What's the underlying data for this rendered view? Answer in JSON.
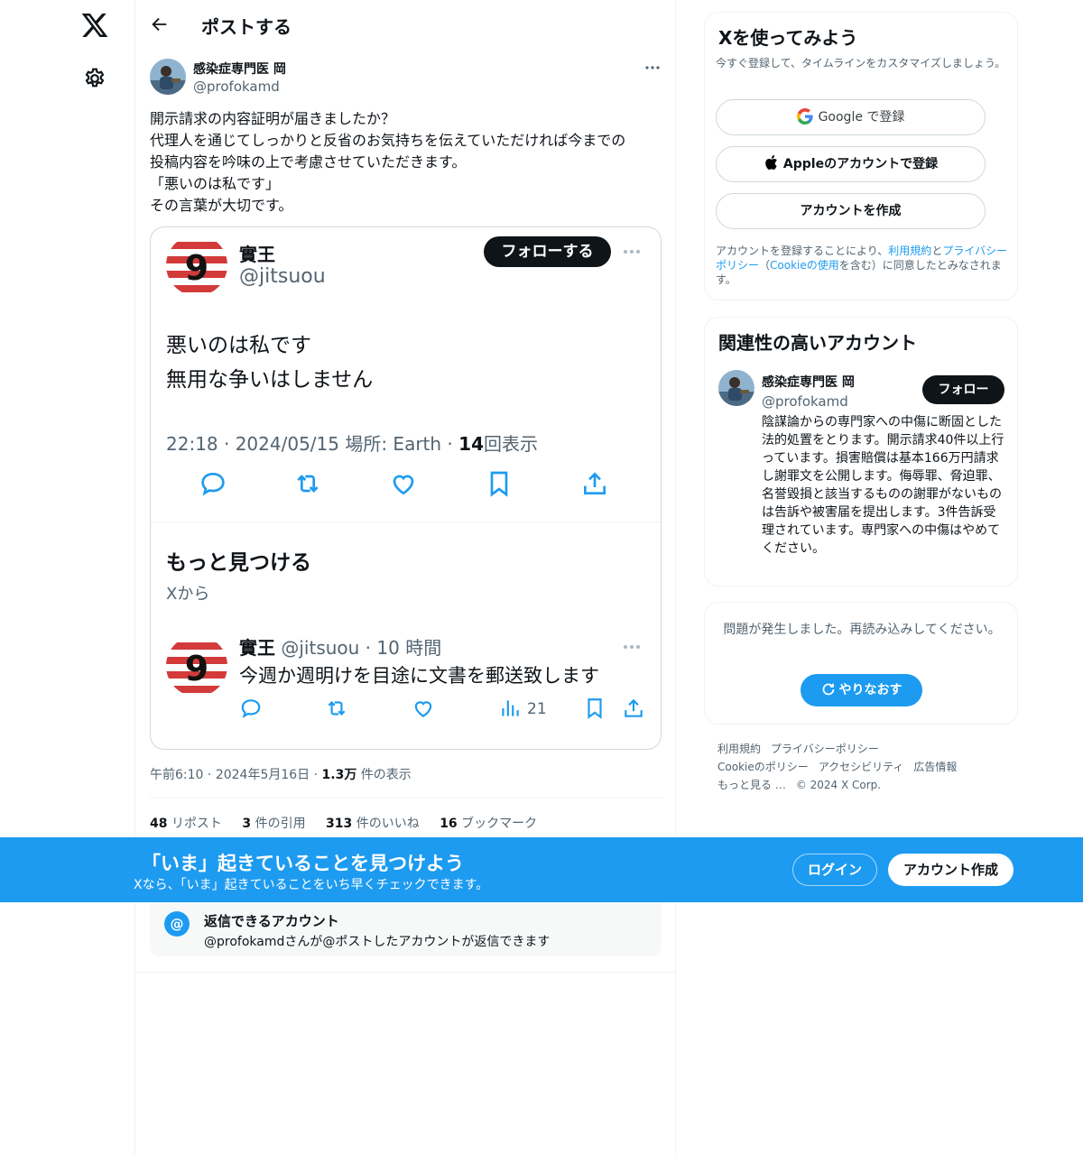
{
  "nav": {
    "logo": "x-logo",
    "settings_icon": "gear-icon"
  },
  "header": {
    "title": "ポストする"
  },
  "post": {
    "author_name": "感染症専門医 岡",
    "author_handle": "@profokamd",
    "text_lines": [
      "開示請求の内容証明が届きましたか？",
      "代理人を通じてしっかりと反省のお気持ちを伝えていただければ今までの",
      "投稿内容を吟味の上で考慮させていただきます。",
      "「悪いのは私です」",
      "その言葉が大切です。"
    ],
    "time": "午前6:10",
    "date": "2024年5月16日",
    "views_count": "1.3万",
    "views_label": "件の表示",
    "stats": {
      "reposts_count": "48",
      "reposts_label": "リポスト",
      "quotes_count": "3",
      "quotes_label": "件の引用",
      "likes_count": "313",
      "likes_label": "件のいいね",
      "bookmarks_count": "16",
      "bookmarks_label": "ブックマーク"
    }
  },
  "embed": {
    "name": "實王",
    "handle": "@jitsuou",
    "follow_label": "フォローする",
    "text_lines": [
      "悪いのは私です",
      "無用な争いはしません"
    ],
    "meta_time": "22:18 · 2024/05/15 場所: Earth ·",
    "meta_views_count": "14",
    "meta_views_label": "回表示",
    "more_title": "もっと見つける",
    "more_sub": "Xから",
    "related": {
      "name": "實王",
      "handle_time": "@jitsuou · 10 時間",
      "text": "今週か週明けを目途に文書を郵送致します",
      "views": "21"
    }
  },
  "reply_restriction": {
    "title": "返信できるアカウント",
    "subtitle": "@profokamdさんが@ポストしたアカウントが返信できます"
  },
  "signup_card": {
    "title": "Xを使ってみよう",
    "subtitle": "今すぐ登録して、タイムラインをカスタマイズしましょう。",
    "google_label": "Google で登録",
    "apple_label": "Appleのアカウントで登録",
    "create_label": "アカウントを作成",
    "terms_pre": "アカウントを登録することにより、",
    "terms_link1": "利用規約",
    "terms_mid": "と",
    "terms_link2": "プライバシーポリシー",
    "terms_mid2": "（",
    "terms_link3": "Cookieの使用",
    "terms_post": "を含む）に同意したとみなされます。"
  },
  "related_card": {
    "title": "関連性の高いアカウント",
    "name": "感染症専門医 岡",
    "handle": "@profokamd",
    "follow_label": "フォロー",
    "bio": "陰謀論からの専門家への中傷に断固とした法的処置をとります。開示請求40件以上行っています。損害賠償は基本166万円請求し謝罪文を公開します。侮辱罪、脅迫罪、名誉毀損と該当するものの謝罪がないものは告訴や被害届を提出します。3件告訴受理されています。専門家への中傷はやめてください。"
  },
  "error_card": {
    "message": "問題が発生しました。再読み込みしてください。",
    "retry_label": "やりなおす"
  },
  "footer": {
    "links": [
      "利用規約",
      "プライバシーポリシー",
      "Cookieのポリシー",
      "アクセシビリティ",
      "広告情報",
      "もっと見る …",
      "© 2024 X Corp."
    ]
  },
  "banner": {
    "title": "「いま」起きていることを見つけよう",
    "subtitle": "Xなら、「いま」起きていることをいち早くチェックできます。",
    "login_label": "ログイン",
    "signup_label": "アカウント作成"
  },
  "colors": {
    "accent": "#1d9bf0",
    "text": "#0f1419",
    "muted": "#536471"
  }
}
